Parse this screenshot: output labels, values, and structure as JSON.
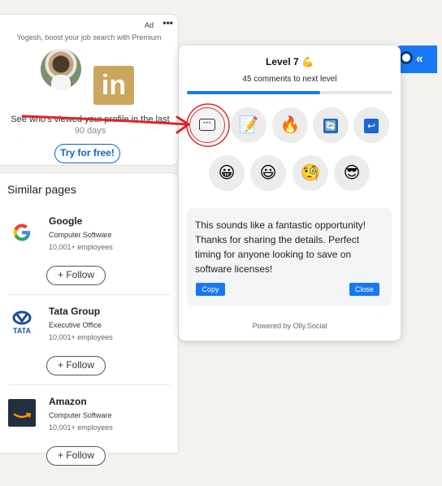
{
  "ad": {
    "label": "Ad",
    "more": "•••",
    "promo": "Yogesh, boost your job search with Premium",
    "text_main": "See who's viewed your profile in the last",
    "text_cut": "90 days",
    "button": "Try for free!",
    "logo_text": "in"
  },
  "similar": {
    "title": "Similar pages",
    "companies": [
      {
        "name": "Google",
        "type": "Computer Software",
        "employees": "10,001+ employees",
        "follow": "+ Follow",
        "logo": "G"
      },
      {
        "name": "Tata Group",
        "type": "Executive Office",
        "employees": "10,001+ employees",
        "follow": "+ Follow",
        "logo": "TATA"
      },
      {
        "name": "Amazon",
        "type": "Computer Software",
        "employees": "10,001+ employees",
        "follow": "+ Follow",
        "logo": "amazon"
      }
    ]
  },
  "popup": {
    "level": "Level 7",
    "level_emoji": "💪",
    "progress_text": "45 comments to next level",
    "progress_fraction": 0.65,
    "emoji_row1": [
      "💬",
      "📝",
      "🔥",
      "🔄",
      "↩"
    ],
    "emoji_row2": [
      "😀",
      "😃",
      "🧐",
      "😎"
    ],
    "comment": "This sounds like a fantastic opportunity! Thanks for sharing the details. Perfect timing for anyone looking to save on software licenses!",
    "copy": "Copy",
    "close": "Close",
    "powered": "Powered by Olly.Social"
  },
  "toggle": {
    "chevron": "«"
  },
  "colors": {
    "accent": "#1877f2",
    "linkedin_blue": "#0a66c2",
    "annotation_red": "#e0242b"
  }
}
